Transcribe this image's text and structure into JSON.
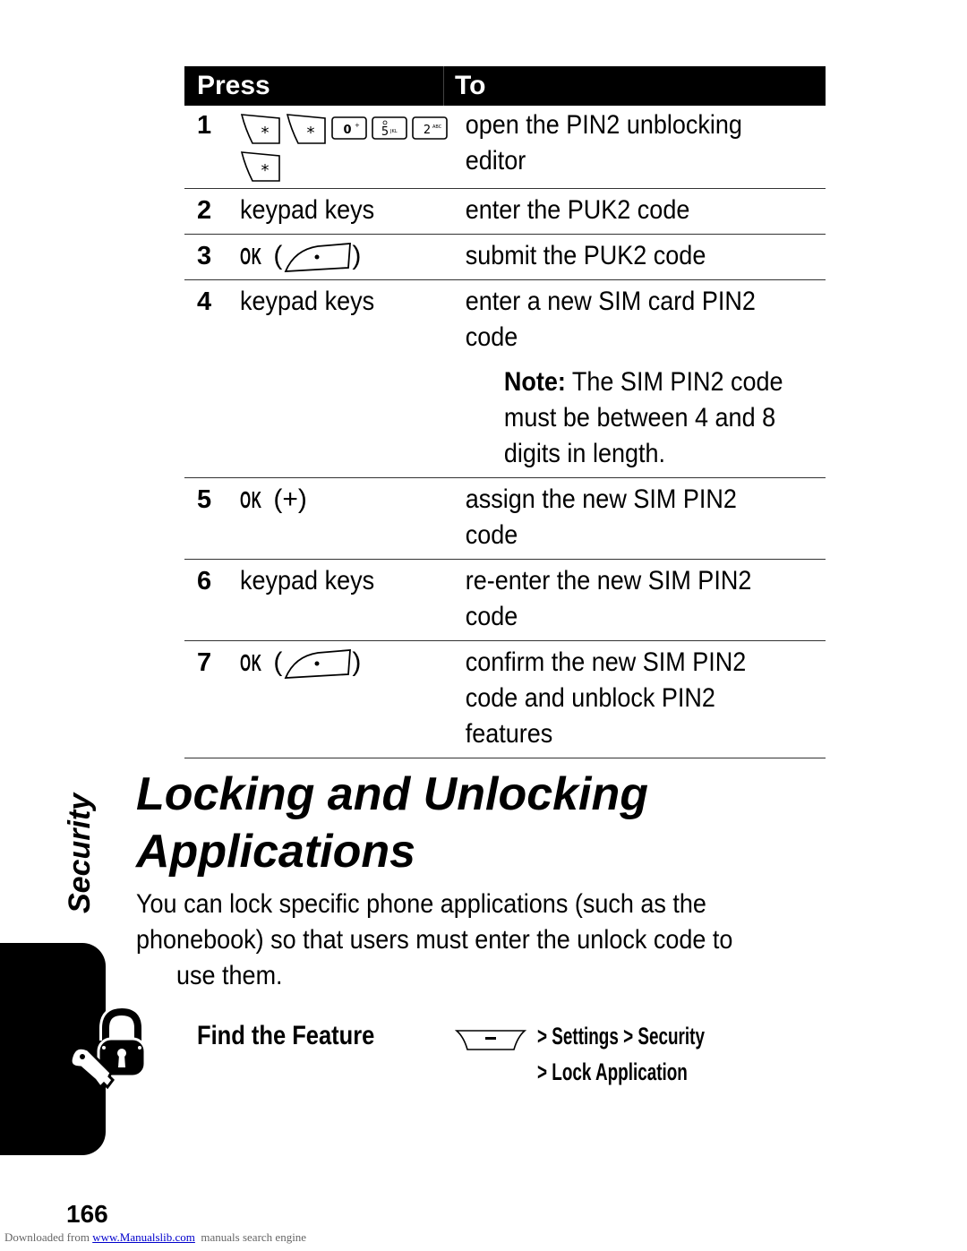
{
  "table": {
    "headers": {
      "press": "Press",
      "to": "To"
    },
    "rows": [
      {
        "num": "1",
        "press_keys": [
          "star-key",
          "star-key",
          "0-key",
          "5-key",
          "2-key",
          "star-key"
        ],
        "to": [
          "open the PIN2 unblocking",
          "editor"
        ]
      },
      {
        "num": "2",
        "press": "keypad keys",
        "to": [
          "enter the PUK2 code"
        ]
      },
      {
        "num": "3",
        "press_ok": "OK",
        "press_key": "right-soft-key",
        "to": [
          "submit the PUK2 code"
        ]
      },
      {
        "num": "4",
        "press": "keypad keys",
        "to": [
          "enter a new SIM card PIN2",
          "code"
        ],
        "note_label": "Note:",
        "note": [
          "The SIM PIN2 code",
          "must be between 4 and 8",
          "digits in length."
        ]
      },
      {
        "num": "5",
        "press_ok": "OK",
        "press_suffix": "(+)",
        "to": [
          "assign the new SIM PIN2",
          "code"
        ]
      },
      {
        "num": "6",
        "press": "keypad keys",
        "to": [
          "re-enter the new SIM PIN2",
          "code"
        ]
      },
      {
        "num": "7",
        "press_ok": "OK",
        "press_key": "right-soft-key",
        "to": [
          "confirm the new SIM PIN2",
          "code and unblock PIN2",
          "features"
        ]
      }
    ],
    "key_labels": {
      "star": "*",
      "zero": "0",
      "five": "5",
      "two": "2"
    }
  },
  "section": {
    "title_line1": "Locking and Unlocking",
    "title_line2": "Applications",
    "body": [
      "You can lock specific phone applications (such as the",
      "phonebook) so that users must enter the unlock code to",
      "use them."
    ]
  },
  "side_tab": {
    "label": "Security",
    "icon": "lock-and-key-icon"
  },
  "find_feature": {
    "label": "Find the Feature",
    "menu_key": "menu-key",
    "path_line1": "> Settings > Security",
    "path_line2": "> Lock Application"
  },
  "page_number": "166",
  "footer": {
    "prefix": "Downloaded from ",
    "link": "www.Manualslib.com",
    "suffix": "  manuals search engine"
  }
}
